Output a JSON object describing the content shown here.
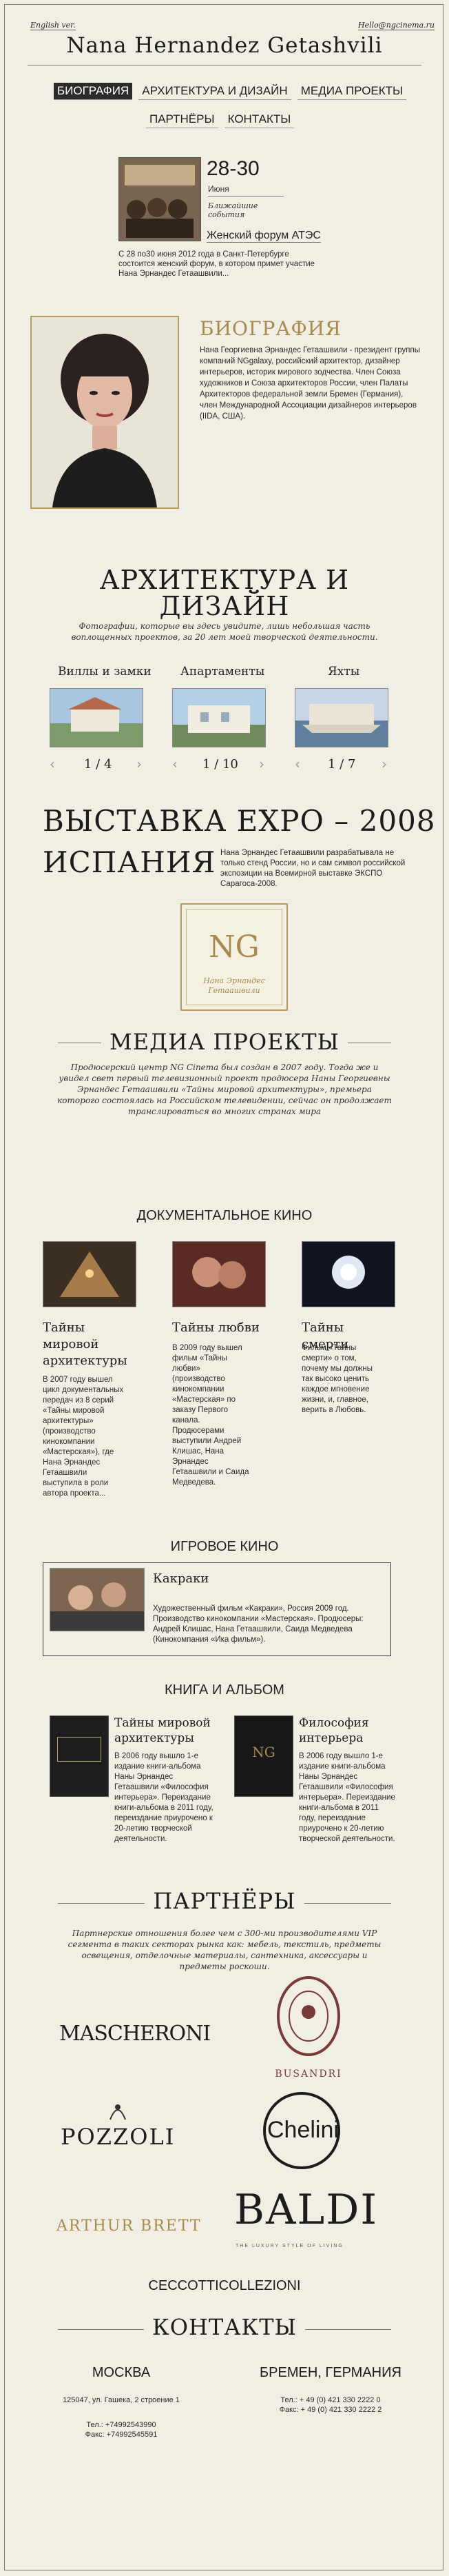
{
  "header": {
    "english_link": "English ver.",
    "email": "Hello@ngcinema.ru",
    "site_title": "Nana Hernandez Getashvili"
  },
  "nav": {
    "items": [
      {
        "label": "БИОГРАФИЯ",
        "active": true
      },
      {
        "label": "АРХИТЕКТУРА И ДИЗАЙН",
        "active": false
      },
      {
        "label": "МЕДИА ПРОЕКТЫ",
        "active": false
      },
      {
        "label": "ПАРТНЁРЫ",
        "active": false
      },
      {
        "label": "КОНТАКТЫ",
        "active": false
      }
    ]
  },
  "event": {
    "date": "28-30",
    "month": "Июня",
    "kind": "Ближайшие события",
    "title": "Женский форум АТЭС",
    "text": "С 28 по30 июня 2012 года в Санкт-Петербурге состоится женский форум, в котором примет участие Нана Эрнандес Гетаашвили..."
  },
  "bio": {
    "title": "БИОГРАФИЯ",
    "text": "Нана Георгиевна Эрнандес Гетаашвили - президент группы компаний NGgalaxy, российский архитектор, дизайнер интерьеров, историк мирового зодчества. Член Союза художников и Союза архитекторов России, член Палаты Архитекторов федеральной земли Бремен (Германия), член Международной Ассоциации дизайнеров интерьеров (IIDA, США)."
  },
  "architecture": {
    "title_line1": "АРХИТЕКТУРА И",
    "title_line2": "ДИЗАЙН",
    "intro": "Фотографии, которые вы здесь увидите, лишь небольшая часть воплощенных проектов, за 20 лет моей творческой деятельности.",
    "galleries": [
      {
        "label": "Виллы и замки",
        "counter": "1 / 4"
      },
      {
        "label": "Апартаменты",
        "counter": "1 / 10"
      },
      {
        "label": "Яхты",
        "counter": "1 / 7"
      }
    ],
    "arrow_prev": "‹",
    "arrow_next": "›"
  },
  "expo": {
    "title_line1": "ВЫСТАВКА EXPO – 2008",
    "title_line2": "ИСПАНИЯ",
    "text": "Нана Эрнандес Гетаашвили разрабатывала не только стенд России, но и сам символ российской экспозиции на Всемирной выставке ЭКСПО Сарагоса-2008.",
    "logo_caption": "Нана Эрнандес Гетаашвили",
    "logo_letters": "NG"
  },
  "media": {
    "title": "МЕДИА ПРОЕКТЫ",
    "intro": "Продюсерский центр NG Cinema был создан в 2007 году. Тогда же и увидел свет первый телевизионный проект продюсера Наны Георгиевны Эрнандес Гетаашвили «Тайны мировой архитектуры», премьера которого состоялась на Российском телевидении, сейчас он продолжает транслироваться во многих странах мира",
    "doc_title": "ДОКУМЕНТАЛЬНОЕ КИНО",
    "docs": [
      {
        "title": "Тайны мировой архитектуры",
        "text": "В 2007 году вышел цикл документальных передач из 8 серий «Тайны мировой архитектуры» (производство кинокомпании «Мастерская»), где Нана Эрнандес Гетаашвили выступила в роли автора проекта..."
      },
      {
        "title": "Тайны любви",
        "text": "В 2009 году вышел фильм «Тайны любви» (производство кинокомпании «Мастерская» по заказу Первого канала. Продюсерами выступили Андрей Клишас, Нана Эрнандес Гетаашвили и Саида Медведева."
      },
      {
        "title": "Тайны смерти",
        "text": "Фильм «Тайны смерти» о том, почему мы должны так высоко ценить каждое мгновение жизни, и, главное, верить в Любовь."
      }
    ],
    "feature_title": "ИГРОВОЕ КИНО",
    "feature": {
      "title": "Какраки",
      "text": "Художественный фильм «Какраки», Россия 2009 год. Производство кинокомпании «Мастерская». Продюсеры: Андрей Клишас, Нана Гетаашвили, Саида Медведева (Кинокомпания «Ика фильм»)."
    },
    "books_title": "КНИГА И АЛЬБОМ",
    "books": [
      {
        "title": "Тайны мировой архитектуры",
        "text": "В 2006 году вышло 1-е издание книги-альбома Наны Эрнандес Гетаашвили «Философия интерьера». Переиздание книги-альбома в 2011 году, переиздание приурочено к 20-летию творческой деятельности."
      },
      {
        "title": "Философия интерьера",
        "text": "В 2006 году вышло 1-е издание книги-альбома Наны Эрнандес Гетаашвили «Философия интерьера». Переиздание книги-альбома в 2011 году, переиздание приурочено к 20-летию творческой деятельности."
      }
    ]
  },
  "partners": {
    "title": "ПАРТНЁРЫ",
    "intro": "Партнерские отношения более чем с 300-ми производителями VIP сегмента в таких секторах рынка как: мебель, текстиль, предметы освещения, отделочные материалы, сантехника, аксессуары и предметы роскоши.",
    "logos": {
      "mascheroni": "MASCHERONI",
      "busandri": "BUSANDRI",
      "pozzoli": "POZZOLI",
      "chelini": "Chelini",
      "arthur_brett": "ARTHUR BRETT",
      "baldi": "BALDI",
      "baldi_tag": "THE LUXURY STYLE OF LIVING",
      "ceccotti": "CECCOTTICOLLEZIONI"
    }
  },
  "contacts": {
    "title": "КОНТАКТЫ",
    "moscow": {
      "city": "МОСКВА",
      "address": "125047, ул. Гашека, 2 строение 1",
      "phone1": "Тел.: +74992543990",
      "phone2": "Факс: +74992545591"
    },
    "bremen": {
      "city": "БРЕМЕН, ГЕРМАНИЯ",
      "phone": "Тел.: + 49 (0) 421 330 2222 0",
      "fax": "Факс: + 49 (0) 421 330 2222 2"
    }
  }
}
